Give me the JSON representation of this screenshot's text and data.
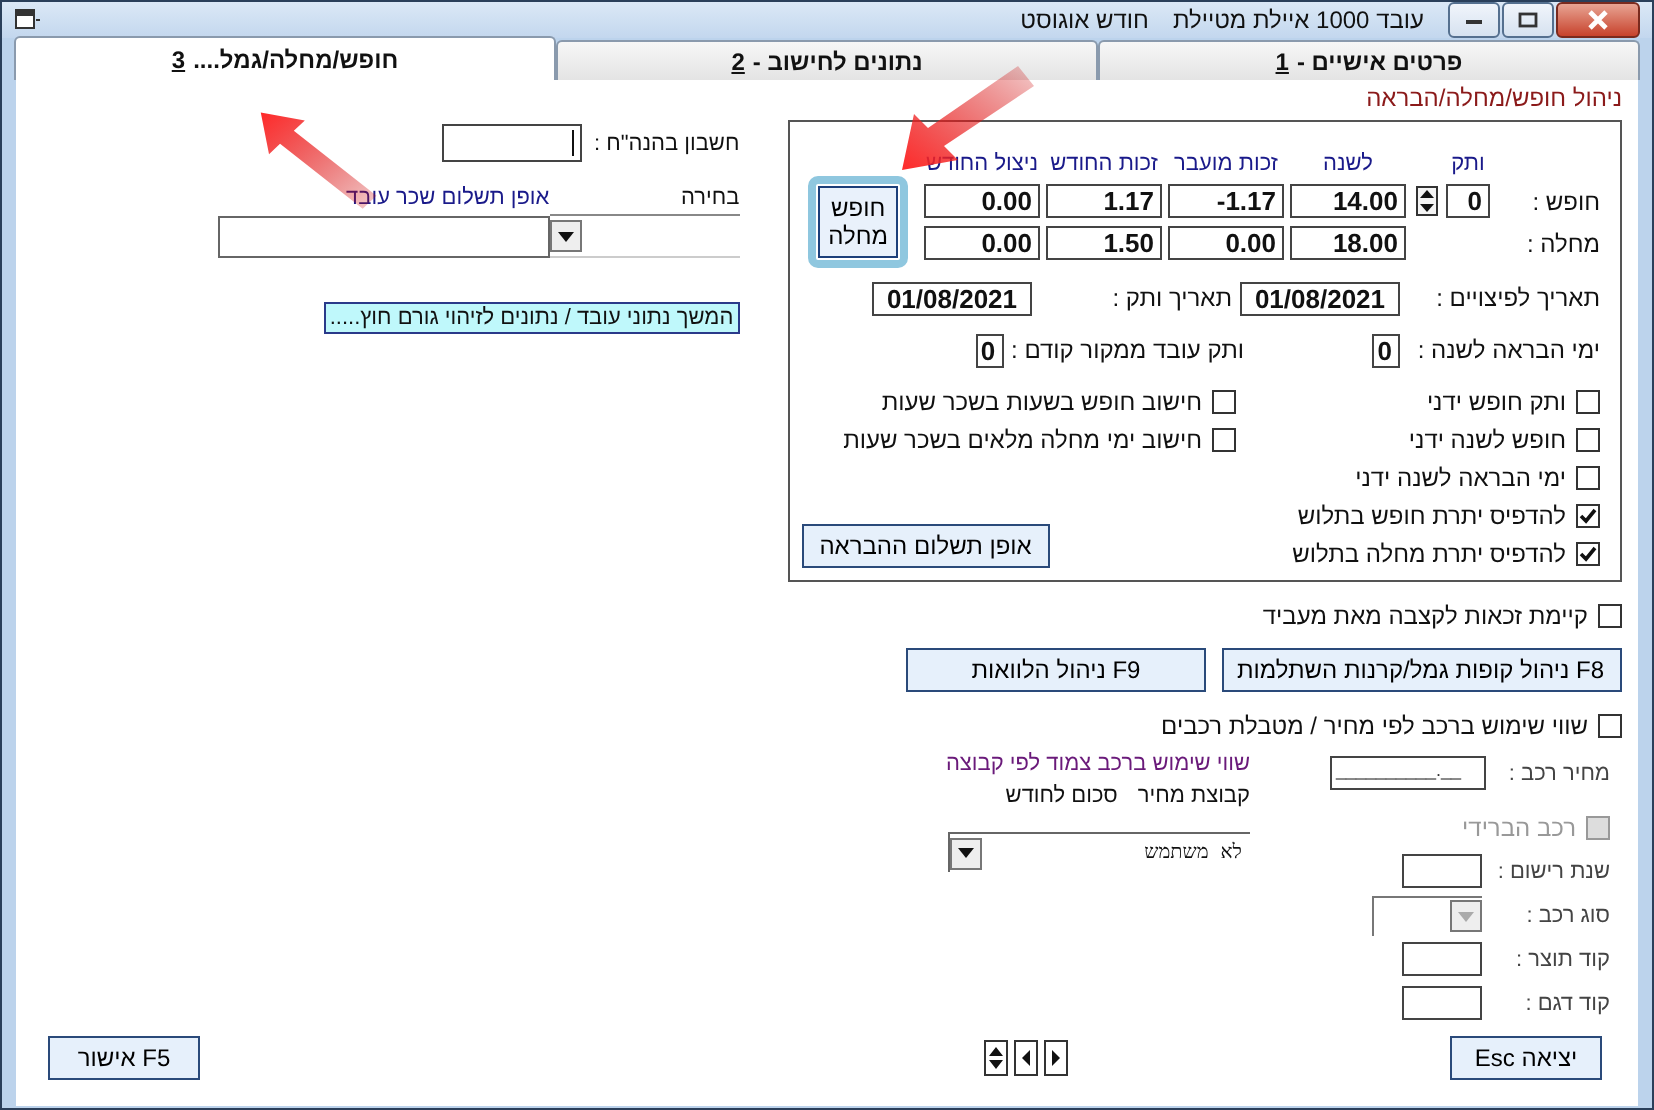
{
  "window": {
    "title": "עובד 1000 איילת מטיילת",
    "month": "חודש אוגוסט"
  },
  "tabs": [
    {
      "label": "פרטים אישיים -",
      "key": "1",
      "selected": false
    },
    {
      "label": "נתונים לחישוב -",
      "key": "2",
      "selected": false
    },
    {
      "label": "חופש/מחלה/גמל....",
      "key": "3",
      "selected": true
    }
  ],
  "leave": {
    "title": "ניהול חופש/מחלה/הבראה",
    "columns": [
      "ותק",
      "לשנה",
      "זכות מועבר",
      "זכות החודש",
      "ניצול החודש"
    ],
    "rows": [
      {
        "label": "חופש :",
        "seniority": "0",
        "values": [
          "14.00",
          "-1.17",
          "1.17",
          "0.00"
        ]
      },
      {
        "label": "מחלה :",
        "values": [
          "18.00",
          "0.00",
          "1.50",
          "0.00"
        ]
      }
    ],
    "toggle_button": [
      "חופש",
      "מחלה"
    ],
    "dates": [
      {
        "label": "תאריך לפיצויים :",
        "value": "01/08/2021"
      },
      {
        "label": "תאריך ותק :",
        "value": "01/08/2021"
      },
      {
        "label": "ימי הבראה לשנה :",
        "value": "0"
      },
      {
        "label": "ותק עובד ממקור קודם :",
        "value": "0"
      }
    ],
    "checks_right": [
      {
        "label": "ותק חופש ידני",
        "checked": false
      },
      {
        "label": "חופש לשנה ידני",
        "checked": false
      },
      {
        "label": "ימי הבראה לשנה ידני",
        "checked": false
      },
      {
        "label": "להדפיס יתרת חופש בתלוש",
        "checked": true
      },
      {
        "label": "להדפיס יתרת מחלה בתלוש",
        "checked": true
      }
    ],
    "checks_left": [
      {
        "label": "חישוב חופש בשעות בשכר שעות",
        "checked": false
      },
      {
        "label": "חישוב ימי מחלה מלאים בשכר שעות",
        "checked": false
      }
    ],
    "payment_button": "אופן תשלום ההבראה"
  },
  "pension_check": {
    "label": "קיימת זכאות לקצבה מאת מעביד",
    "checked": false
  },
  "fund_buttons": [
    "F8 ניהול קופות גמל/קרנות השתלמות",
    "F9 ניהול הלוואות"
  ],
  "car_check": {
    "label": "שווי שימוש ברכב לפי מחיר / מטבלת רכבים",
    "checked": false
  },
  "car_fields": [
    {
      "kind": "input",
      "label": "מחיר רכב :",
      "value": "__________.__"
    },
    {
      "kind": "checkbox",
      "label": "רכב הברידי",
      "checked": false,
      "disabled": true
    },
    {
      "kind": "input",
      "label": "שנת רישום :"
    },
    {
      "kind": "combo",
      "label": "סוג רכב :",
      "disabled": true
    },
    {
      "kind": "input",
      "label": "קוד תוצר :"
    },
    {
      "kind": "input",
      "label": "קוד דגם :"
    }
  ],
  "car_group": {
    "title": "שווי שימוש ברכב צמוד לפי קבוצה",
    "headers": [
      "קבוצת מחיר",
      "סכום לחודש"
    ],
    "value": "לא משתמש"
  },
  "account": {
    "label": "חשבון בהנה\"ח :"
  },
  "salary": {
    "headers": [
      "בחירה",
      "אופן תשלום שכר עובד"
    ]
  },
  "link": "המשך נתוני עובד / נתונים לזיהוי גורם חוץ.....",
  "footer": {
    "exit": "יציאה Esc",
    "ok": "F5 אישור"
  }
}
